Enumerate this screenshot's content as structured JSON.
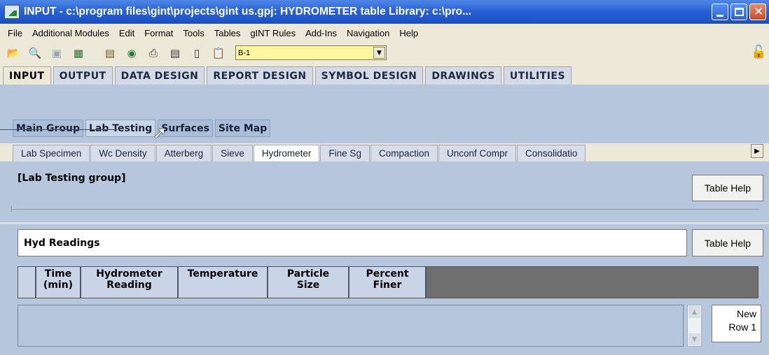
{
  "window": {
    "title": "INPUT -  c:\\program files\\gint\\projects\\gint us.gpj: HYDROMETER table    Library: c:\\pro..."
  },
  "menu": [
    "File",
    "Additional Modules",
    "Edit",
    "Format",
    "Tools",
    "Tables",
    "gINT Rules",
    "Add-Ins",
    "Navigation",
    "Help"
  ],
  "toolbar": {
    "icons": [
      "open-folder-icon",
      "print-preview-icon",
      "save-icon",
      "table-icon",
      "notepad-icon",
      "eye-icon",
      "printer-icon",
      "list-icon",
      "new-page-icon",
      "clipboard-icon"
    ],
    "boring_select": "B-1"
  },
  "main_tabs": [
    "INPUT",
    "OUTPUT",
    "DATA DESIGN",
    "REPORT DESIGN",
    "SYMBOL DESIGN",
    "DRAWINGS",
    "UTILITIES"
  ],
  "group_tabs": [
    "Main Group",
    "Lab Testing",
    "Surfaces",
    "Site Map"
  ],
  "table_tabs": [
    "Lab Specimen",
    "Wc Density",
    "Atterberg",
    "Sieve",
    "Hydrometer",
    "Fine Sg",
    "Compaction",
    "Unconf Compr",
    "Consolidatio"
  ],
  "group_panel": {
    "label": "[Lab Testing group]",
    "help": "Table Help"
  },
  "hyd_panel": {
    "label": "Hyd Readings",
    "help": "Table Help",
    "columns": [
      {
        "line1": "Time",
        "line2": "(min)"
      },
      {
        "line1": "Hydrometer",
        "line2": "Reading"
      },
      {
        "line1": "Temperature",
        "line2": ""
      },
      {
        "line1": "Particle",
        "line2": "Size"
      },
      {
        "line1": "Percent",
        "line2": "Finer"
      }
    ],
    "new_row": {
      "line1": "New",
      "line2": "Row 1"
    }
  }
}
